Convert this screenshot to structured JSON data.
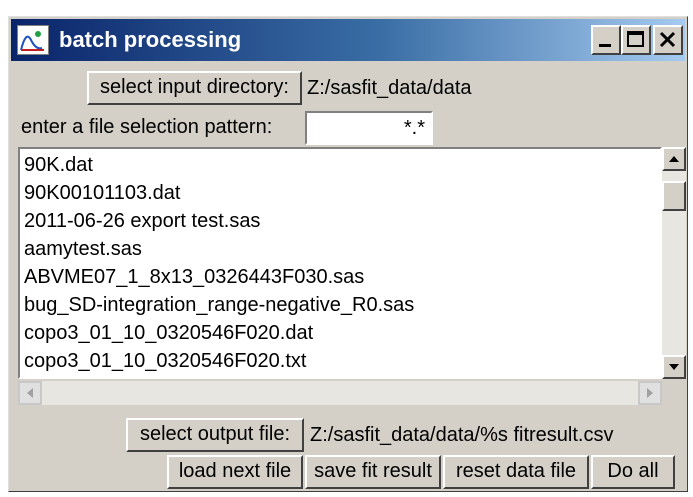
{
  "window": {
    "title": "batch processing"
  },
  "input_dir": {
    "button_label": "select input directory:",
    "value": "Z:/sasfit_data/data"
  },
  "pattern": {
    "label": "enter a file selection pattern:",
    "value": "*.*"
  },
  "files": {
    "items": [
      "90K.dat",
      "90K00101103.dat",
      "2011-06-26 export test.sas",
      "aamytest.sas",
      "ABVME07_1_8x13_0326443F030.sas",
      "bug_SD-integration_range-negative_R0.sas",
      "copo3_01_10_0320546F020.dat",
      "copo3_01_10_0320546F020.txt"
    ]
  },
  "output": {
    "button_label": "select output file:",
    "value": "Z:/sasfit_data/data/%s fitresult.csv"
  },
  "actions": {
    "load_next": "load next file",
    "save_fit": "save fit result",
    "reset_data": "reset data file",
    "do_all": "Do all"
  },
  "colors": {
    "titlebar_start": "#0a246a",
    "titlebar_end": "#a6caf0",
    "face": "#d4d0c8"
  }
}
